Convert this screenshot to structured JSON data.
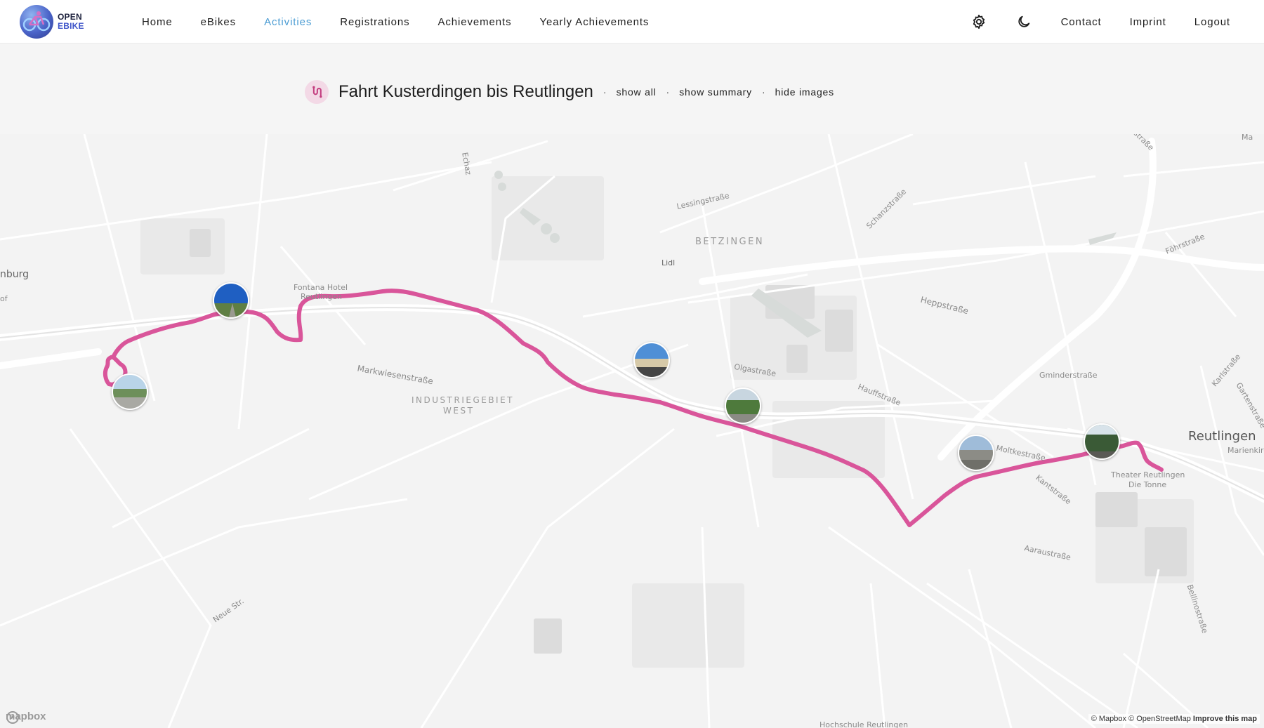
{
  "logo": {
    "line1": "OPEN",
    "line2": "EBIKE",
    "icon": "bike-logo-icon"
  },
  "nav": {
    "items": [
      {
        "label": "Home"
      },
      {
        "label": "eBikes"
      },
      {
        "label": "Activities",
        "active": true
      },
      {
        "label": "Registrations"
      },
      {
        "label": "Achievements"
      },
      {
        "label": "Yearly Achievements"
      }
    ],
    "active_color": "#4b9cd3"
  },
  "right_nav": {
    "settings_icon": "gear-icon",
    "theme_icon": "moon-icon",
    "contact": "Contact",
    "imprint": "Imprint",
    "logout": "Logout"
  },
  "activity": {
    "icon": "route-icon",
    "title": "Fahrt Kusterdingen bis Reutlingen",
    "show_all": "show all",
    "show_summary": "show summary",
    "hide_images": "hide images",
    "separator": "·"
  },
  "map": {
    "route_color": "#d9559a",
    "labels": {
      "burg": "nburg",
      "of": "of",
      "echaz": "Echaz",
      "lessing": "Lessingstraße",
      "schanz": "Schanzstraße",
      "fohr": "Föhrstraße",
      "betzingen": "BETZINGEN",
      "lidl": "Lidl",
      "hotel1": "Fontana Hotel",
      "hotel2": "Reutlingen",
      "markwiesen": "Markwiesenstraße",
      "industrie1": "INDUSTRIEGEBIET",
      "industrie2": "WEST",
      "heppstr": "Heppstraße",
      "olga": "Olgastraße",
      "hauff": "Hauffstraße",
      "gminder": "Gminderstraße",
      "karl": "Karlstraße",
      "garten": "Gartenstraße",
      "reutlingen": "Reutlingen",
      "marien": "Marienkirche",
      "moltke": "Moltkestraße",
      "kant": "Kantstraße",
      "theater1": "Theater Reutlingen",
      "theater2": "Die Tonne",
      "aarau": "Aaraustraße",
      "bellino": "Bellinostraße",
      "neue": "Neue Str.",
      "hochschule": "Hochschule Reutlingen",
      "chstr": "chstraße",
      "ma": "Ma"
    },
    "mapbox_logo": "mapbox",
    "attribution": "© Mapbox © OpenStreetMap",
    "improve": "Improve this map",
    "photos": [
      {
        "name": "photo-1",
        "scene": "field"
      },
      {
        "name": "photo-2",
        "scene": "sky-path"
      },
      {
        "name": "photo-3",
        "scene": "street"
      },
      {
        "name": "photo-4",
        "scene": "tree-road"
      },
      {
        "name": "photo-5",
        "scene": "city-street"
      },
      {
        "name": "photo-6",
        "scene": "trees"
      }
    ]
  }
}
